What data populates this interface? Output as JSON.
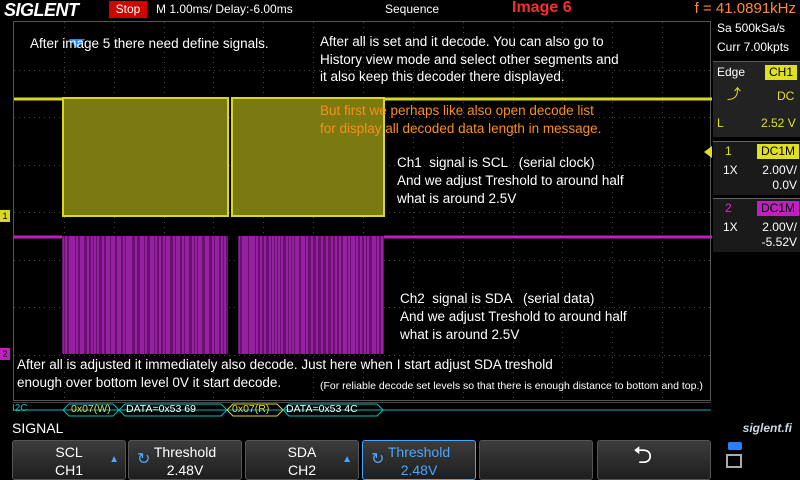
{
  "topbar": {
    "logo": "SIGLENT",
    "status": "Stop",
    "timebase": "M 1.00ms/ Delay:-6.00ms",
    "mode": "Sequence",
    "image_label": "Image 6",
    "frequency": "f = 41.0891kHz"
  },
  "right_panel": {
    "sample_rate": "Sa 500kSa/s",
    "memory": "Curr 7.00kpts",
    "trigger": {
      "type": "Edge",
      "source": "CH1",
      "coupling": "DC",
      "level_label": "L",
      "level": "2.52 V"
    },
    "ch1": {
      "num": "1",
      "coupling": "DC1M",
      "probe": "1X",
      "scale": "2.00V/",
      "offset": "0.0V"
    },
    "ch2": {
      "num": "2",
      "coupling": "DC1M",
      "probe": "1X",
      "scale": "2.00V/",
      "offset": "-5.52V"
    }
  },
  "notes": {
    "n1": "After image 5 there need define signals.",
    "n2_l1": "After all is set and it decode. You can also go to",
    "n2_l2": "History view mode and select other segments and",
    "n2_l3": "it also keep this decoder there displayed.",
    "n3_l1": "But first we perhaps like also open decode list",
    "n3_l2": "for display all decoded data length in message.",
    "ch1_l1": "Ch1  signal is SCL   (serial clock)",
    "ch1_l2": "And we adjust Treshold to around half",
    "ch1_l3": "what is around 2.5V",
    "ch2_l1": "Ch2  signal is SDA   (serial data)",
    "ch2_l2": "And we adjust Treshold to around half",
    "ch2_l3": "what is around 2.5V",
    "bottom_l1": "After all is adjusted it immediately also decode. Just here when I start adjust SDA treshold",
    "bottom_l2": "enough over bottom level 0V it start decode.",
    "bottom_small": "(For reliable decode set levels so that there is enough distance to bottom and top.)"
  },
  "decode": {
    "protocol": "I2C",
    "packet1_addr": "0x07(W)",
    "packet1_data": "DATA=0x53 69",
    "packet2_addr": "0x07(R)",
    "packet2_data": "DATA=0x53 4C"
  },
  "menu": {
    "title": "SIGNAL",
    "brand": "siglent.fi",
    "scl_label": "SCL",
    "scl_value": "CH1",
    "scl_threshold_label": "Threshold",
    "scl_threshold_value": "2.48V",
    "sda_label": "SDA",
    "sda_value": "CH2",
    "sda_threshold_label": "Threshold",
    "sda_threshold_value": "2.48V"
  },
  "colors": {
    "ch1": "#d8d820",
    "ch1_fill": "#7a7a10",
    "ch2": "#c020c0",
    "ch2_fill": "#6a1070",
    "accent": "#49a6ff",
    "note": "#ff8c1a"
  }
}
